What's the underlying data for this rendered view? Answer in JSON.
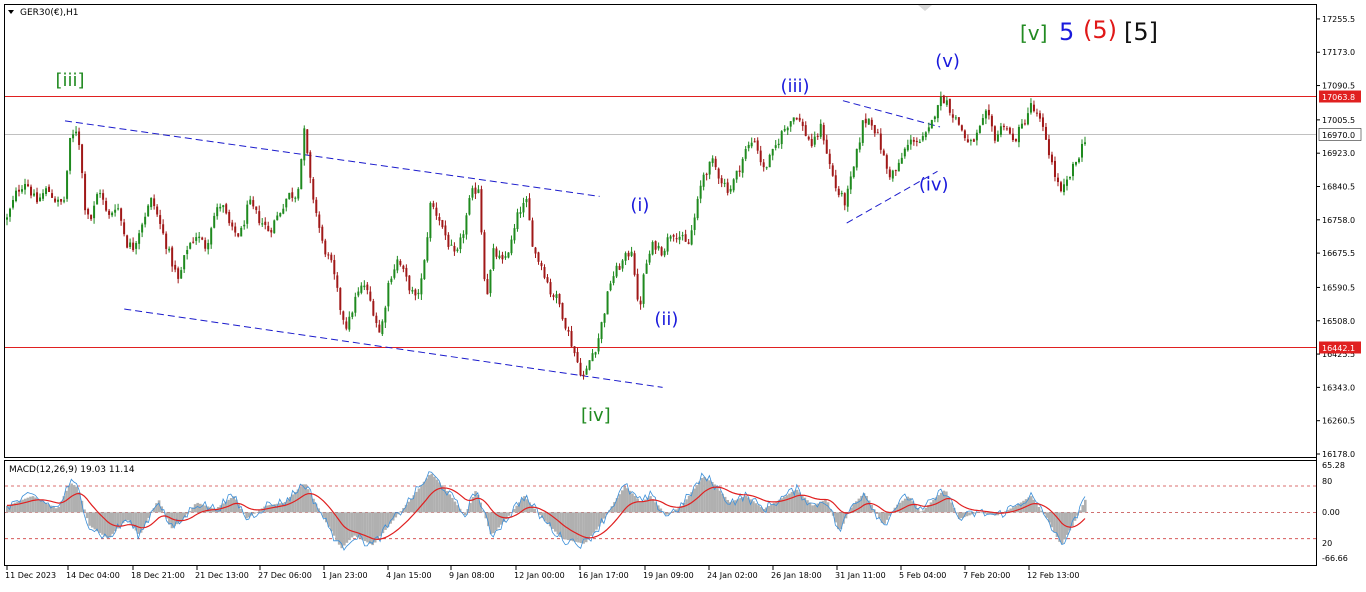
{
  "header": {
    "symbol_label": "GER30(€),H1",
    "menu_icon": "triangle-down-icon",
    "corner_icon": "chart-corner-marker-icon"
  },
  "wave_labels_top": [
    {
      "text": "[v]",
      "color": "#228b22"
    },
    {
      "text": "5",
      "color": "#1a1adc"
    },
    {
      "text": "(5)",
      "color": "#e01818"
    },
    {
      "text": "[5]",
      "color": "#111111"
    }
  ],
  "colors": {
    "up_candle": "#1f8a1f",
    "down_candle": "#a01818",
    "level_line": "#e02020",
    "trend_line": "#1a1acc",
    "green_label": "#228b22",
    "blue_label": "#1a1adc",
    "macd_hist": "#b0b0b0",
    "macd_main": "#3b8fd9",
    "macd_signal": "#e02020"
  },
  "chart_data": [
    {
      "type": "candlestick",
      "symbol": "GER30(€)",
      "timeframe": "H1",
      "ylim": [
        16178,
        17290
      ],
      "y_ticks": [
        17255.5,
        17173.0,
        17090.5,
        17005.5,
        16923.0,
        16840.5,
        16758.0,
        16675.5,
        16590.5,
        16508.0,
        16425.5,
        16343.0,
        16260.5,
        16178.0
      ],
      "x_tick_labels": [
        "11 Dec 2023",
        "14 Dec 04:00",
        "18 Dec 21:00",
        "21 Dec 13:00",
        "27 Dec 06:00",
        "1 Jan 23:00",
        "4 Jan 15:00",
        "9 Jan 08:00",
        "12 Jan 00:00",
        "16 Jan 17:00",
        "19 Jan 09:00",
        "24 Jan 02:00",
        "26 Jan 18:00",
        "31 Jan 11:00",
        "5 Feb 04:00",
        "7 Feb 20:00",
        "12 Feb 13:00"
      ],
      "close_path": [
        [
          0,
          16760
        ],
        [
          0.8,
          16830
        ],
        [
          1.5,
          16855
        ],
        [
          2.3,
          16800
        ],
        [
          3.2,
          16835
        ],
        [
          4,
          16800
        ],
        [
          4.5,
          16800
        ],
        [
          5,
          16950
        ],
        [
          5.6,
          16990
        ],
        [
          6.2,
          16790
        ],
        [
          6.7,
          16760
        ],
        [
          7.3,
          16840
        ],
        [
          8,
          16760
        ],
        [
          8.7,
          16800
        ],
        [
          9.5,
          16700
        ],
        [
          10,
          16690
        ],
        [
          10.8,
          16760
        ],
        [
          11.5,
          16810
        ],
        [
          12.3,
          16730
        ],
        [
          13,
          16660
        ],
        [
          13.6,
          16605
        ],
        [
          14.3,
          16690
        ],
        [
          15,
          16720
        ],
        [
          15.8,
          16690
        ],
        [
          16.3,
          16760
        ],
        [
          17,
          16800
        ],
        [
          17.8,
          16730
        ],
        [
          18.5,
          16720
        ],
        [
          19.2,
          16800
        ],
        [
          20,
          16760
        ],
        [
          20.8,
          16730
        ],
        [
          21.5,
          16770
        ],
        [
          22.3,
          16820
        ],
        [
          23,
          16820
        ],
        [
          23.6,
          16980
        ],
        [
          24,
          16860
        ],
        [
          24.5,
          16780
        ],
        [
          25,
          16700
        ],
        [
          25.8,
          16640
        ],
        [
          26.5,
          16530
        ],
        [
          27,
          16490
        ],
        [
          27.6,
          16560
        ],
        [
          28.3,
          16600
        ],
        [
          29,
          16540
        ],
        [
          29.6,
          16470
        ],
        [
          30.3,
          16610
        ],
        [
          31,
          16660
        ],
        [
          31.8,
          16600
        ],
        [
          32.4,
          16560
        ],
        [
          33,
          16620
        ],
        [
          33.6,
          16800
        ],
        [
          34.3,
          16760
        ],
        [
          35,
          16700
        ],
        [
          35.6,
          16660
        ],
        [
          36.2,
          16730
        ],
        [
          36.8,
          16820
        ],
        [
          37.4,
          16840
        ],
        [
          38,
          16560
        ],
        [
          38.6,
          16680
        ],
        [
          39.3,
          16650
        ],
        [
          40,
          16700
        ],
        [
          40.6,
          16780
        ],
        [
          41.2,
          16800
        ],
        [
          41.8,
          16680
        ],
        [
          42.5,
          16640
        ],
        [
          43.1,
          16580
        ],
        [
          43.7,
          16560
        ],
        [
          44.3,
          16500
        ],
        [
          44.9,
          16440
        ],
        [
          45.4,
          16390
        ],
        [
          45.8,
          16365
        ],
        [
          46.3,
          16420
        ],
        [
          46.8,
          16450
        ],
        [
          47.3,
          16520
        ],
        [
          47.9,
          16610
        ],
        [
          48.5,
          16640
        ],
        [
          49,
          16660
        ],
        [
          49.6,
          16690
        ],
        [
          50.1,
          16520
        ],
        [
          50.6,
          16640
        ],
        [
          51.3,
          16700
        ],
        [
          52,
          16680
        ],
        [
          52.7,
          16730
        ],
        [
          53.3,
          16720
        ],
        [
          54,
          16690
        ],
        [
          54.6,
          16770
        ],
        [
          55.2,
          16870
        ],
        [
          56,
          16900
        ],
        [
          56.6,
          16860
        ],
        [
          57.3,
          16830
        ],
        [
          58,
          16880
        ],
        [
          58.6,
          16930
        ],
        [
          59.3,
          16960
        ],
        [
          60,
          16880
        ],
        [
          60.7,
          16920
        ],
        [
          61.4,
          16970
        ],
        [
          62,
          17000
        ],
        [
          62.6,
          17020
        ],
        [
          63.2,
          16980
        ],
        [
          63.9,
          16940
        ],
        [
          64.6,
          16990
        ],
        [
          65.2,
          16900
        ],
        [
          65.8,
          16830
        ],
        [
          66.5,
          16800
        ],
        [
          67.2,
          16890
        ],
        [
          67.9,
          17000
        ],
        [
          68.5,
          17010
        ],
        [
          69.2,
          16950
        ],
        [
          69.9,
          16870
        ],
        [
          70.6,
          16880
        ],
        [
          71.2,
          16930
        ],
        [
          71.9,
          16960
        ],
        [
          72.5,
          16950
        ],
        [
          73.2,
          16980
        ],
        [
          73.8,
          17050
        ],
        [
          74.4,
          17060
        ],
        [
          75,
          17020
        ],
        [
          75.6,
          16990
        ],
        [
          76.3,
          16940
        ],
        [
          77,
          16970
        ],
        [
          77.7,
          17020
        ],
        [
          78.4,
          16960
        ],
        [
          79.1,
          17000
        ],
        [
          79.8,
          16950
        ],
        [
          80.5,
          16990
        ],
        [
          81.2,
          17040
        ],
        [
          81.8,
          17010
        ],
        [
          82.4,
          16960
        ],
        [
          83,
          16880
        ],
        [
          83.6,
          16820
        ],
        [
          84.2,
          16860
        ],
        [
          84.9,
          16910
        ],
        [
          85.5,
          16960
        ]
      ],
      "horizontal_levels": [
        {
          "price": 17063.8,
          "label": "17063.8",
          "kind": "line"
        },
        {
          "price": 16970.0,
          "label": "16970.0",
          "kind": "current"
        },
        {
          "price": 16442.1,
          "label": "16442.1",
          "kind": "line"
        }
      ],
      "trend_lines": [
        {
          "from": [
            4.6,
            17003
          ],
          "to": [
            47,
            16816
          ]
        },
        {
          "from": [
            9.3,
            16537
          ],
          "to": [
            52,
            16343
          ]
        },
        {
          "from": [
            66.3,
            17053
          ],
          "to": [
            74,
            16988
          ]
        },
        {
          "from": [
            66.6,
            16750
          ],
          "to": [
            73.8,
            16878
          ]
        }
      ],
      "wave_annotations": [
        {
          "text": "[iii]",
          "color": "green",
          "x": 5,
          "price": 17090
        },
        {
          "text": "[iv]",
          "color": "green",
          "x": 46.7,
          "price": 16260
        },
        {
          "text": "(i)",
          "color": "blue",
          "x": 50.2,
          "price": 16780
        },
        {
          "text": "(ii)",
          "color": "blue",
          "x": 52.3,
          "price": 16497
        },
        {
          "text": "(iii)",
          "color": "blue",
          "x": 62.5,
          "price": 17075
        },
        {
          "text": "(iv)",
          "color": "blue",
          "x": 73.5,
          "price": 16830
        },
        {
          "text": "(v)",
          "color": "blue",
          "x": 74.6,
          "price": 17137
        }
      ]
    },
    {
      "type": "macd",
      "title": "MACD(12,26,9) 19.03 11.14",
      "parameters": [
        12,
        26,
        9
      ],
      "macd_value": 19.03,
      "signal_value": 11.14,
      "ylim": [
        -80,
        78
      ],
      "y_tick_labels": [
        "65.28",
        "80",
        "0.00",
        "20",
        "-66.66"
      ],
      "levels": [
        40,
        0,
        -40
      ],
      "keypoints": [
        [
          0,
          10
        ],
        [
          2,
          25
        ],
        [
          4,
          5
        ],
        [
          5,
          45
        ],
        [
          5.6,
          38
        ],
        [
          6.5,
          -20
        ],
        [
          8,
          -40
        ],
        [
          9.5,
          -10
        ],
        [
          10.5,
          -35
        ],
        [
          12,
          20
        ],
        [
          13,
          -25
        ],
        [
          14,
          -10
        ],
        [
          15,
          15
        ],
        [
          16.5,
          5
        ],
        [
          18,
          25
        ],
        [
          19,
          -10
        ],
        [
          20.5,
          10
        ],
        [
          22,
          15
        ],
        [
          23.6,
          45
        ],
        [
          25,
          -5
        ],
        [
          26.5,
          -55
        ],
        [
          27.5,
          -35
        ],
        [
          29,
          -50
        ],
        [
          30.5,
          -15
        ],
        [
          32,
          20
        ],
        [
          33.6,
          60
        ],
        [
          35,
          30
        ],
        [
          36.3,
          -5
        ],
        [
          37.2,
          35
        ],
        [
          38.4,
          -35
        ],
        [
          39.6,
          -10
        ],
        [
          41,
          25
        ],
        [
          42.5,
          -10
        ],
        [
          44,
          -40
        ],
        [
          45.8,
          -48
        ],
        [
          47,
          -20
        ],
        [
          48.3,
          20
        ],
        [
          49,
          40
        ],
        [
          50.3,
          15
        ],
        [
          51,
          25
        ],
        [
          52.3,
          -5
        ],
        [
          53.5,
          10
        ],
        [
          55.2,
          55
        ],
        [
          56,
          45
        ],
        [
          57.3,
          15
        ],
        [
          58.6,
          25
        ],
        [
          60,
          5
        ],
        [
          61.3,
          20
        ],
        [
          62.6,
          35
        ],
        [
          63.9,
          10
        ],
        [
          65,
          20
        ],
        [
          66,
          -30
        ],
        [
          67,
          10
        ],
        [
          68,
          30
        ],
        [
          69.5,
          -20
        ],
        [
          70.5,
          10
        ],
        [
          71.5,
          25
        ],
        [
          72.5,
          0
        ],
        [
          73.5,
          20
        ],
        [
          74.4,
          35
        ],
        [
          75.5,
          -10
        ],
        [
          77,
          0
        ],
        [
          78.5,
          -5
        ],
        [
          80,
          10
        ],
        [
          81.2,
          25
        ],
        [
          82.5,
          -10
        ],
        [
          83.6,
          -50
        ],
        [
          84.5,
          -20
        ],
        [
          85.5,
          19
        ]
      ]
    }
  ],
  "axis": {
    "price_labels": [
      "17255.5",
      "17173.0",
      "17090.5",
      "17005.5",
      "16923.0",
      "16840.5",
      "16758.0",
      "16675.5",
      "16590.5",
      "16508.0",
      "16425.5",
      "16343.0",
      "16260.5",
      "16178.0"
    ],
    "macd_labels": [
      "65.28",
      "80",
      "0.00",
      "20",
      "-66.66"
    ],
    "time_labels": [
      "11 Dec 2023",
      "14 Dec 04:00",
      "18 Dec 21:00",
      "21 Dec 13:00",
      "27 Dec 06:00",
      "1 Jan 23:00",
      "4 Jan 15:00",
      "9 Jan 08:00",
      "12 Jan 00:00",
      "16 Jan 17:00",
      "19 Jan 09:00",
      "24 Jan 02:00",
      "26 Jan 18:00",
      "31 Jan 11:00",
      "5 Feb 04:00",
      "7 Feb 20:00",
      "12 Feb 13:00"
    ]
  }
}
